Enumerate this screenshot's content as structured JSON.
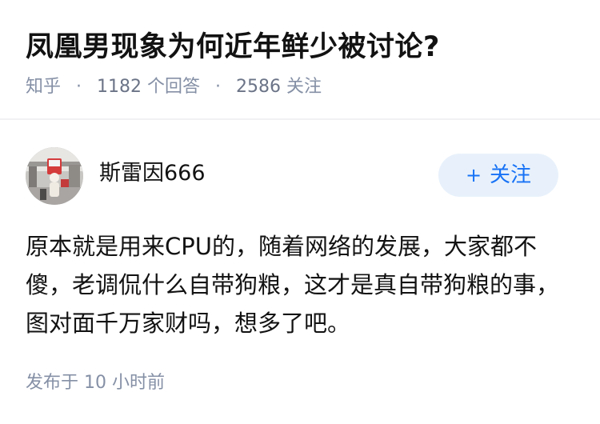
{
  "question": {
    "title": "凤凰男现象为何近年鲜少被讨论?",
    "source": "知乎",
    "separator": "·",
    "answer_count": "1182",
    "answer_suffix": "个回答",
    "follower_count": "2586",
    "follower_suffix": "关注"
  },
  "answer": {
    "author_name": "斯雷因666",
    "follow_label": "关注",
    "follow_plus": "+",
    "content": "原本就是用来CPU的，随着网络的发展，大家都不傻，老调侃什么自带狗粮，这才是真自带狗粮的事，图对面千万家财吗，想多了吧。",
    "published_prefix": "发布于",
    "published_time": "10 小时前"
  },
  "colors": {
    "accent": "#1772f6",
    "follow_bg": "#e8f1fb",
    "meta_text": "#8590a6",
    "title_text": "#121212",
    "divider": "#f1f1f3"
  },
  "icons": {
    "avatar": "user-avatar-photo"
  }
}
